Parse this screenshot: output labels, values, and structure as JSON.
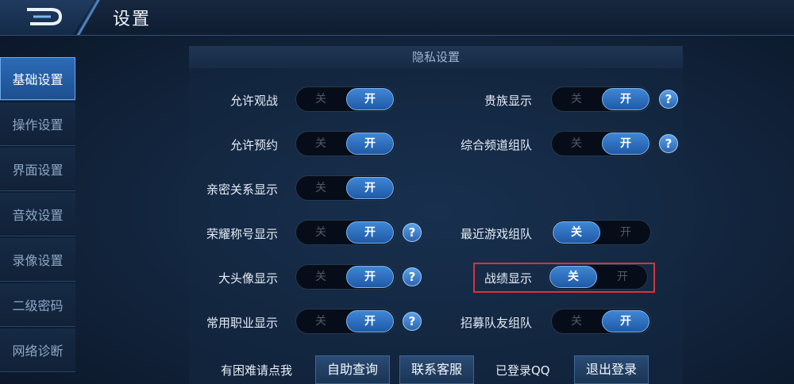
{
  "header": {
    "title": "设置"
  },
  "sidebar": {
    "items": [
      {
        "label": "基础设置",
        "active": true
      },
      {
        "label": "操作设置"
      },
      {
        "label": "界面设置"
      },
      {
        "label": "音效设置"
      },
      {
        "label": "录像设置"
      },
      {
        "label": "二级密码"
      },
      {
        "label": "网络诊断"
      }
    ]
  },
  "privacy": {
    "section_title": "隐私设置",
    "off_label": "关",
    "on_label": "开",
    "help_glyph": "?",
    "left": [
      {
        "label": "允许观战",
        "state": "on"
      },
      {
        "label": "允许预约",
        "state": "on"
      },
      {
        "label": "亲密关系显示",
        "state": "on"
      },
      {
        "label": "荣耀称号显示",
        "state": "on",
        "help": true
      },
      {
        "label": "大头像显示",
        "state": "on",
        "help": true
      },
      {
        "label": "常用职业显示",
        "state": "on",
        "help": true
      }
    ],
    "right": [
      {
        "label": "贵族显示",
        "state": "on",
        "help": true
      },
      {
        "label": "综合频道组队",
        "state": "on",
        "help": true
      },
      {
        "label": "最近游戏组队",
        "state": "off"
      },
      {
        "label": "战绩显示",
        "state": "off",
        "highlighted": true
      },
      {
        "label": "招募队友组队",
        "state": "on"
      }
    ]
  },
  "footer": {
    "help_prompt": "有困难请点我",
    "self_service_label": "自助查询",
    "contact_label": "联系客服",
    "login_status": "已登录QQ",
    "logout_label": "退出登录"
  },
  "colors": {
    "accent": "#2f74c4",
    "highlight_box": "#d9333b"
  }
}
